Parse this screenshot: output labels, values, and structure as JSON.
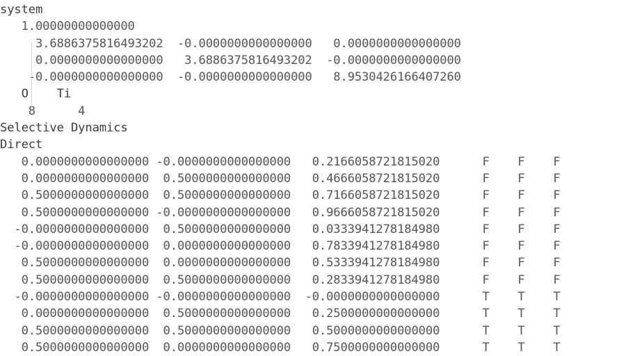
{
  "document": {
    "format": "POSCAR",
    "background_color": "#ffffff",
    "text_color": "#4a4a4a",
    "comment_line": "system",
    "scaling_factor": "1.00000000000000",
    "lattice_label": "lattice_vectors",
    "lattice_vectors": [
      [
        "3.6886375816493202",
        "-0.0000000000000000",
        "0.0000000000000000"
      ],
      [
        "0.0000000000000000",
        "3.6886375816493202",
        "-0.0000000000000000"
      ],
      [
        "-0.0000000000000000",
        "-0.0000000000000000",
        "8.9530426166407260"
      ]
    ],
    "element_symbols": [
      "O",
      "Ti"
    ],
    "element_counts": [
      "8",
      "4"
    ],
    "selective_dynamics_line": "Selective Dynamics",
    "coordinate_mode_line": "Direct",
    "positions": [
      {
        "x": "0.0000000000000000",
        "y": "-0.0000000000000000",
        "z": "0.2166058721815020",
        "fx": "F",
        "fy": "F",
        "fz": "F"
      },
      {
        "x": "0.0000000000000000",
        "y": "0.5000000000000000",
        "z": "0.4666058721815020",
        "fx": "F",
        "fy": "F",
        "fz": "F"
      },
      {
        "x": "0.5000000000000000",
        "y": "0.5000000000000000",
        "z": "0.7166058721815020",
        "fx": "F",
        "fy": "F",
        "fz": "F"
      },
      {
        "x": "0.5000000000000000",
        "y": "-0.0000000000000000",
        "z": "0.9666058721815020",
        "fx": "F",
        "fy": "F",
        "fz": "F"
      },
      {
        "x": "-0.0000000000000000",
        "y": "0.5000000000000000",
        "z": "0.0333941278184980",
        "fx": "F",
        "fy": "F",
        "fz": "F"
      },
      {
        "x": "-0.0000000000000000",
        "y": "0.0000000000000000",
        "z": "0.7833941278184980",
        "fx": "F",
        "fy": "F",
        "fz": "F"
      },
      {
        "x": "0.5000000000000000",
        "y": "0.0000000000000000",
        "z": "0.5333941278184980",
        "fx": "F",
        "fy": "F",
        "fz": "F"
      },
      {
        "x": "0.5000000000000000",
        "y": "0.5000000000000000",
        "z": "0.2833941278184980",
        "fx": "F",
        "fy": "F",
        "fz": "F"
      },
      {
        "x": "-0.0000000000000000",
        "y": "-0.0000000000000000",
        "z": "-0.0000000000000000",
        "fx": "T",
        "fy": "T",
        "fz": "T"
      },
      {
        "x": "0.0000000000000000",
        "y": "0.5000000000000000",
        "z": "0.2500000000000000",
        "fx": "T",
        "fy": "T",
        "fz": "T"
      },
      {
        "x": "0.5000000000000000",
        "y": "0.5000000000000000",
        "z": "0.5000000000000000",
        "fx": "T",
        "fy": "T",
        "fz": "T"
      },
      {
        "x": "0.5000000000000000",
        "y": "0.0000000000000000",
        "z": "0.7500000000000000",
        "fx": "T",
        "fy": "T",
        "fz": "T"
      }
    ]
  }
}
